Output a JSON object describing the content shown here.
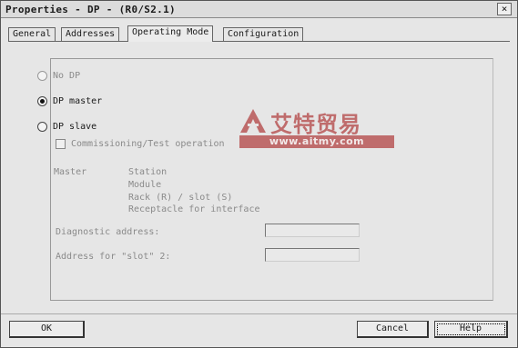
{
  "window": {
    "title": "Properties - DP - (R0/S2.1)",
    "close_label": "×"
  },
  "tabs": [
    {
      "label": "General"
    },
    {
      "label": "Addresses"
    },
    {
      "label": "Operating Mode"
    },
    {
      "label": "Configuration"
    }
  ],
  "operating_mode": {
    "options": [
      {
        "label": "No DP",
        "selected": false,
        "enabled": false
      },
      {
        "label": "DP master",
        "selected": true,
        "enabled": true
      },
      {
        "label": "DP slave",
        "selected": false,
        "enabled": true
      }
    ],
    "commissioning_checkbox_label": "Commissioning/Test operation",
    "master_label": "Master",
    "master_fields": [
      "Station",
      "Module",
      "Rack (R) / slot (S)",
      "Receptacle for interface"
    ],
    "diagnostic_address_label": "Diagnostic address:",
    "diagnostic_address_value": "",
    "slot2_address_label": "Address for \"slot\" 2:",
    "slot2_address_value": ""
  },
  "watermark": {
    "chinese": "艾特贸易",
    "url": "www.aitmy.com"
  },
  "buttons": {
    "ok": "OK",
    "cancel": "Cancel",
    "help": "Help"
  }
}
